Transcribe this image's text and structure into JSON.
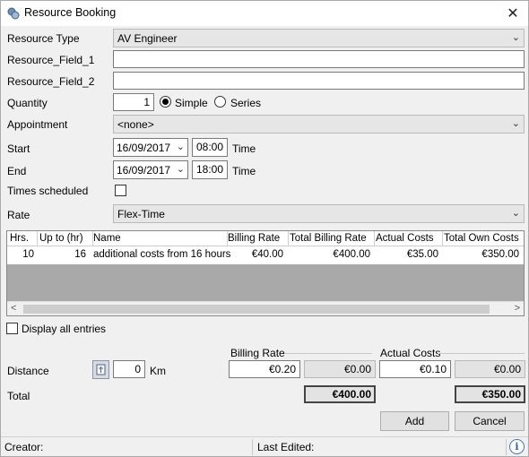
{
  "window": {
    "title": "Resource Booking"
  },
  "labels": {
    "resource_type": "Resource Type",
    "field1": "Resource_Field_1",
    "field2": "Resource_Field_2",
    "quantity": "Quantity",
    "appointment": "Appointment",
    "start": "Start",
    "end": "End",
    "times_scheduled": "Times scheduled",
    "rate": "Rate",
    "time": "Time",
    "display_all": "Display all entries",
    "distance": "Distance",
    "km": "Km",
    "total": "Total",
    "billing_rate_group": "Billing Rate",
    "actual_costs_group": "Actual Costs"
  },
  "form": {
    "resource_type": "AV Engineer",
    "field1": "",
    "field2": "",
    "quantity": "1",
    "mode_simple": "Simple",
    "mode_series": "Series",
    "mode_selected": "Simple",
    "appointment": "<none>",
    "start_date": "16/09/2017",
    "start_time": "08:00",
    "end_date": "16/09/2017",
    "end_time": "18:00",
    "times_scheduled": false,
    "rate": "Flex-Time",
    "display_all": false,
    "distance": "0"
  },
  "grid": {
    "columns": [
      "Hrs.",
      "Up to (hr)",
      "Name",
      "Billing Rate",
      "Total Billing Rate",
      "Actual Costs",
      "Total Own Costs"
    ],
    "rows": [
      {
        "hrs": "10",
        "upto": "16",
        "name": "additional costs from 16 hours",
        "billing_rate": "€40.00",
        "total_billing": "€400.00",
        "actual_costs": "€35.00",
        "total_own": "€350.00"
      }
    ]
  },
  "costs": {
    "billing_rate_value": "€0.20",
    "billing_rate_extra": "€0.00",
    "actual_costs_value": "€0.10",
    "actual_costs_extra": "€0.00",
    "total_billing": "€400.00",
    "total_actual": "€350.00"
  },
  "buttons": {
    "add": "Add",
    "cancel": "Cancel"
  },
  "status": {
    "creator": "Creator:",
    "last_edited": "Last Edited:"
  },
  "icons": [
    "app-icon",
    "close-icon",
    "chevron-down-icon",
    "calculator-icon",
    "info-icon"
  ]
}
